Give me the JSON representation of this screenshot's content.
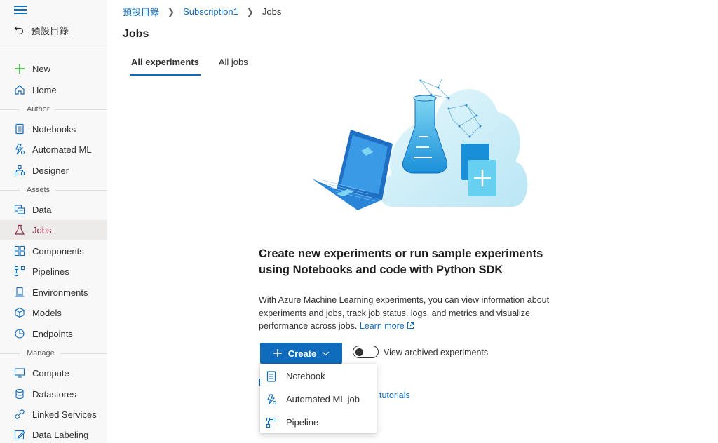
{
  "sidebar": {
    "back_label": "預設目錄",
    "items_top": [
      {
        "label": "New",
        "icon": "plus-icon"
      },
      {
        "label": "Home",
        "icon": "home-icon"
      }
    ],
    "section_author": "Author",
    "items_author": [
      {
        "label": "Notebooks",
        "icon": "notebook-icon"
      },
      {
        "label": "Automated ML",
        "icon": "automl-icon"
      },
      {
        "label": "Designer",
        "icon": "designer-icon"
      }
    ],
    "section_assets": "Assets",
    "items_assets": [
      {
        "label": "Data",
        "icon": "data-icon"
      },
      {
        "label": "Jobs",
        "icon": "flask-icon"
      },
      {
        "label": "Components",
        "icon": "components-icon"
      },
      {
        "label": "Pipelines",
        "icon": "pipeline-icon"
      },
      {
        "label": "Environments",
        "icon": "environment-icon"
      },
      {
        "label": "Models",
        "icon": "model-icon"
      },
      {
        "label": "Endpoints",
        "icon": "endpoint-icon"
      }
    ],
    "section_manage": "Manage",
    "items_manage": [
      {
        "label": "Compute",
        "icon": "compute-icon"
      },
      {
        "label": "Datastores",
        "icon": "datastore-icon"
      },
      {
        "label": "Linked Services",
        "icon": "linked-services-icon"
      },
      {
        "label": "Data Labeling",
        "icon": "data-labeling-icon"
      }
    ]
  },
  "breadcrumb": [
    "預設目錄",
    "Subscription1",
    "Jobs"
  ],
  "page_title": "Jobs",
  "tabs": [
    "All experiments",
    "All jobs"
  ],
  "empty_state": {
    "heading": "Create new experiments or run sample experiments using Notebooks and code with Python SDK",
    "description": "With Azure Machine Learning experiments, you can view information about experiments and jobs, track job status, logs, and metrics and visualize performance across jobs.",
    "learn_more": "Learn more"
  },
  "create_button": "Create",
  "toggle_label": "View archived experiments",
  "behind_link_text": "tutorials",
  "dropdown": [
    {
      "label": "Notebook",
      "icon": "notebook-icon"
    },
    {
      "label": "Automated ML job",
      "icon": "automl-icon"
    },
    {
      "label": "Pipeline",
      "icon": "pipeline-icon"
    }
  ],
  "colors": {
    "accent": "#0f6cbd",
    "highlight": "#ff6b7a"
  }
}
